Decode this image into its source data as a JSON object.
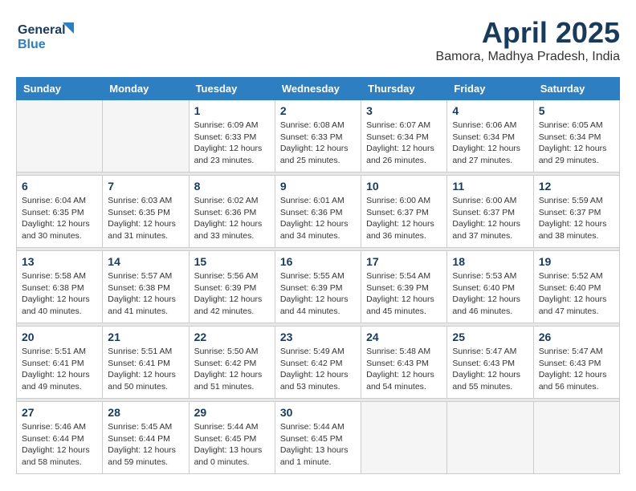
{
  "header": {
    "logo_line1": "General",
    "logo_line2": "Blue",
    "month": "April 2025",
    "location": "Bamora, Madhya Pradesh, India"
  },
  "days_of_week": [
    "Sunday",
    "Monday",
    "Tuesday",
    "Wednesday",
    "Thursday",
    "Friday",
    "Saturday"
  ],
  "weeks": [
    [
      {
        "day": "",
        "info": ""
      },
      {
        "day": "",
        "info": ""
      },
      {
        "day": "1",
        "sunrise": "Sunrise: 6:09 AM",
        "sunset": "Sunset: 6:33 PM",
        "daylight": "Daylight: 12 hours and 23 minutes."
      },
      {
        "day": "2",
        "sunrise": "Sunrise: 6:08 AM",
        "sunset": "Sunset: 6:33 PM",
        "daylight": "Daylight: 12 hours and 25 minutes."
      },
      {
        "day": "3",
        "sunrise": "Sunrise: 6:07 AM",
        "sunset": "Sunset: 6:34 PM",
        "daylight": "Daylight: 12 hours and 26 minutes."
      },
      {
        "day": "4",
        "sunrise": "Sunrise: 6:06 AM",
        "sunset": "Sunset: 6:34 PM",
        "daylight": "Daylight: 12 hours and 27 minutes."
      },
      {
        "day": "5",
        "sunrise": "Sunrise: 6:05 AM",
        "sunset": "Sunset: 6:34 PM",
        "daylight": "Daylight: 12 hours and 29 minutes."
      }
    ],
    [
      {
        "day": "6",
        "sunrise": "Sunrise: 6:04 AM",
        "sunset": "Sunset: 6:35 PM",
        "daylight": "Daylight: 12 hours and 30 minutes."
      },
      {
        "day": "7",
        "sunrise": "Sunrise: 6:03 AM",
        "sunset": "Sunset: 6:35 PM",
        "daylight": "Daylight: 12 hours and 31 minutes."
      },
      {
        "day": "8",
        "sunrise": "Sunrise: 6:02 AM",
        "sunset": "Sunset: 6:36 PM",
        "daylight": "Daylight: 12 hours and 33 minutes."
      },
      {
        "day": "9",
        "sunrise": "Sunrise: 6:01 AM",
        "sunset": "Sunset: 6:36 PM",
        "daylight": "Daylight: 12 hours and 34 minutes."
      },
      {
        "day": "10",
        "sunrise": "Sunrise: 6:00 AM",
        "sunset": "Sunset: 6:37 PM",
        "daylight": "Daylight: 12 hours and 36 minutes."
      },
      {
        "day": "11",
        "sunrise": "Sunrise: 6:00 AM",
        "sunset": "Sunset: 6:37 PM",
        "daylight": "Daylight: 12 hours and 37 minutes."
      },
      {
        "day": "12",
        "sunrise": "Sunrise: 5:59 AM",
        "sunset": "Sunset: 6:37 PM",
        "daylight": "Daylight: 12 hours and 38 minutes."
      }
    ],
    [
      {
        "day": "13",
        "sunrise": "Sunrise: 5:58 AM",
        "sunset": "Sunset: 6:38 PM",
        "daylight": "Daylight: 12 hours and 40 minutes."
      },
      {
        "day": "14",
        "sunrise": "Sunrise: 5:57 AM",
        "sunset": "Sunset: 6:38 PM",
        "daylight": "Daylight: 12 hours and 41 minutes."
      },
      {
        "day": "15",
        "sunrise": "Sunrise: 5:56 AM",
        "sunset": "Sunset: 6:39 PM",
        "daylight": "Daylight: 12 hours and 42 minutes."
      },
      {
        "day": "16",
        "sunrise": "Sunrise: 5:55 AM",
        "sunset": "Sunset: 6:39 PM",
        "daylight": "Daylight: 12 hours and 44 minutes."
      },
      {
        "day": "17",
        "sunrise": "Sunrise: 5:54 AM",
        "sunset": "Sunset: 6:39 PM",
        "daylight": "Daylight: 12 hours and 45 minutes."
      },
      {
        "day": "18",
        "sunrise": "Sunrise: 5:53 AM",
        "sunset": "Sunset: 6:40 PM",
        "daylight": "Daylight: 12 hours and 46 minutes."
      },
      {
        "day": "19",
        "sunrise": "Sunrise: 5:52 AM",
        "sunset": "Sunset: 6:40 PM",
        "daylight": "Daylight: 12 hours and 47 minutes."
      }
    ],
    [
      {
        "day": "20",
        "sunrise": "Sunrise: 5:51 AM",
        "sunset": "Sunset: 6:41 PM",
        "daylight": "Daylight: 12 hours and 49 minutes."
      },
      {
        "day": "21",
        "sunrise": "Sunrise: 5:51 AM",
        "sunset": "Sunset: 6:41 PM",
        "daylight": "Daylight: 12 hours and 50 minutes."
      },
      {
        "day": "22",
        "sunrise": "Sunrise: 5:50 AM",
        "sunset": "Sunset: 6:42 PM",
        "daylight": "Daylight: 12 hours and 51 minutes."
      },
      {
        "day": "23",
        "sunrise": "Sunrise: 5:49 AM",
        "sunset": "Sunset: 6:42 PM",
        "daylight": "Daylight: 12 hours and 53 minutes."
      },
      {
        "day": "24",
        "sunrise": "Sunrise: 5:48 AM",
        "sunset": "Sunset: 6:43 PM",
        "daylight": "Daylight: 12 hours and 54 minutes."
      },
      {
        "day": "25",
        "sunrise": "Sunrise: 5:47 AM",
        "sunset": "Sunset: 6:43 PM",
        "daylight": "Daylight: 12 hours and 55 minutes."
      },
      {
        "day": "26",
        "sunrise": "Sunrise: 5:47 AM",
        "sunset": "Sunset: 6:43 PM",
        "daylight": "Daylight: 12 hours and 56 minutes."
      }
    ],
    [
      {
        "day": "27",
        "sunrise": "Sunrise: 5:46 AM",
        "sunset": "Sunset: 6:44 PM",
        "daylight": "Daylight: 12 hours and 58 minutes."
      },
      {
        "day": "28",
        "sunrise": "Sunrise: 5:45 AM",
        "sunset": "Sunset: 6:44 PM",
        "daylight": "Daylight: 12 hours and 59 minutes."
      },
      {
        "day": "29",
        "sunrise": "Sunrise: 5:44 AM",
        "sunset": "Sunset: 6:45 PM",
        "daylight": "Daylight: 13 hours and 0 minutes."
      },
      {
        "day": "30",
        "sunrise": "Sunrise: 5:44 AM",
        "sunset": "Sunset: 6:45 PM",
        "daylight": "Daylight: 13 hours and 1 minute."
      },
      {
        "day": "",
        "info": ""
      },
      {
        "day": "",
        "info": ""
      },
      {
        "day": "",
        "info": ""
      }
    ]
  ]
}
